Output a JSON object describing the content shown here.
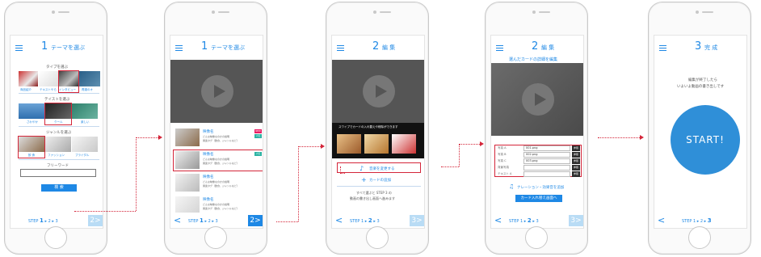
{
  "colors": {
    "accent": "#1e88e5",
    "highlight": "#d4263a",
    "disabled_next": "#b9dcf5"
  },
  "step_nav": {
    "prev": "<",
    "next": "2>",
    "step_label": "STEP",
    "n1": "1",
    "sep1": "▸",
    "n2": "2",
    "sep2": "▸",
    "n3": "3"
  },
  "screen1": {
    "step_number": "1",
    "title": "テーマを選ぶ",
    "type_label": "タイプを選ぶ",
    "type_items": [
      "商品紹介",
      "テキストやら",
      "インタビュー",
      "再媒のオ"
    ],
    "taste_label": "テイストを選ぶ",
    "taste_items": [
      "さわやか",
      "クール",
      "楽しい"
    ],
    "genre_label": "ジャンルを選ぶ",
    "genre_items": [
      "飲 食",
      "ファッション",
      "ブライダル"
    ],
    "freeword_label": "フリーワード",
    "search_button": "検 索"
  },
  "screen2": {
    "step_number": "1",
    "title": "テーマを選ぶ",
    "items": [
      {
        "name": "映像名",
        "desc1": "どんな映像なのかの説明",
        "desc2": "関連タグ（飲食、ジャンルなど）",
        "tags": [
          "NEW",
          "人気"
        ]
      },
      {
        "name": "映像名",
        "desc1": "どんな映像なのかの説明",
        "desc2": "関連タグ（飲食、ジャンルなど）",
        "tags": [
          "人気"
        ]
      },
      {
        "name": "映像名",
        "desc1": "どんな映像なのかの説明",
        "desc2": "関連タグ（飲食、ジャンルなど）",
        "tags": []
      },
      {
        "name": "映像名",
        "desc1": "どんな映像なのかの説明",
        "desc2": "関連タグ（飲食、ジャンルなど）",
        "tags": []
      }
    ]
  },
  "screen3": {
    "step_number": "2",
    "title": "編 集",
    "swipe_hint": "スワイプでカードの入れ替えや削除ができます",
    "music_button": "音楽を変更する",
    "add_card": "カードの追加",
    "notice1": "すべて選ぶと STEP 3 の",
    "notice2": "動画の書き出し画面へ進みます"
  },
  "screen4": {
    "step_number": "2",
    "title": "編 集",
    "subtitle": "選んだカードの詳細を編集",
    "fields": [
      {
        "label": "写真 A",
        "value": "001.png",
        "btn": "参照"
      },
      {
        "label": "写真 B",
        "value": "002.png",
        "btn": "参照"
      },
      {
        "label": "写真 C",
        "value": "003.png",
        "btn": "参照"
      },
      {
        "label": "背景写真",
        "value": "",
        "btn": "参照"
      },
      {
        "label": "テキスト A",
        "value": "",
        "btn": "参照"
      }
    ],
    "narration": "ナレーション・効果音を追加",
    "card_swap": "カード入れ替え画面へ"
  },
  "screen5": {
    "step_number": "3",
    "title": "完 成",
    "msg1": "編集が終了したら",
    "msg2": "いよいよ動画の書き出しです",
    "start_button": "START!"
  }
}
